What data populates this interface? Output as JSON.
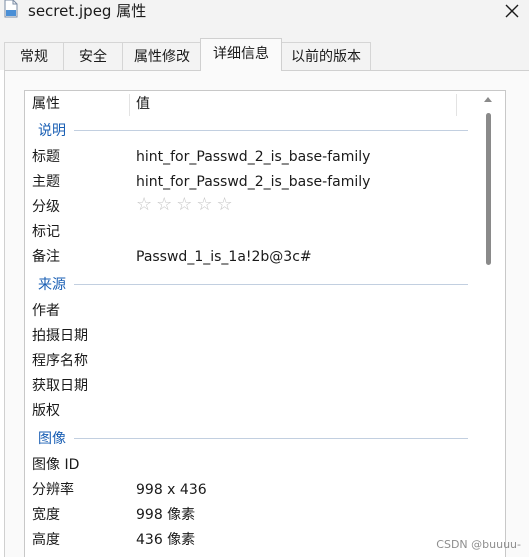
{
  "window": {
    "title": "secret.jpeg 属性",
    "close_icon": "close-icon",
    "file_icon": "image-file-icon"
  },
  "tabs": [
    {
      "label": "常规",
      "active": false
    },
    {
      "label": "安全",
      "active": false
    },
    {
      "label": "属性修改",
      "active": false
    },
    {
      "label": "详细信息",
      "active": true
    },
    {
      "label": "以前的版本",
      "active": false
    }
  ],
  "table": {
    "col_property": "属性",
    "col_value": "值"
  },
  "groups": {
    "description": {
      "label": "说明",
      "rows": [
        {
          "name": "标题",
          "value": "hint_for_Passwd_2_is_base-family"
        },
        {
          "name": "主题",
          "value": "hint_for_Passwd_2_is_base-family"
        },
        {
          "name": "分级",
          "value": "☆☆☆☆☆"
        },
        {
          "name": "标记",
          "value": ""
        },
        {
          "name": "备注",
          "value": "Passwd_1_is_1a!2b@3c#"
        }
      ]
    },
    "origin": {
      "label": "来源",
      "rows": [
        {
          "name": "作者",
          "value": ""
        },
        {
          "name": "拍摄日期",
          "value": ""
        },
        {
          "name": "程序名称",
          "value": ""
        },
        {
          "name": "获取日期",
          "value": ""
        },
        {
          "name": "版权",
          "value": ""
        }
      ]
    },
    "image": {
      "label": "图像",
      "rows": [
        {
          "name": "图像 ID",
          "value": ""
        },
        {
          "name": "分辨率",
          "value": "998 x 436"
        },
        {
          "name": "宽度",
          "value": "998 像素"
        },
        {
          "name": "高度",
          "value": "436 像素"
        }
      ]
    }
  },
  "watermark": "CSDN @buuuu-",
  "colors": {
    "group_label": "#1a5fb4",
    "star_empty": "#c6c6c6",
    "scroll_thumb": "#8a8a8a"
  }
}
